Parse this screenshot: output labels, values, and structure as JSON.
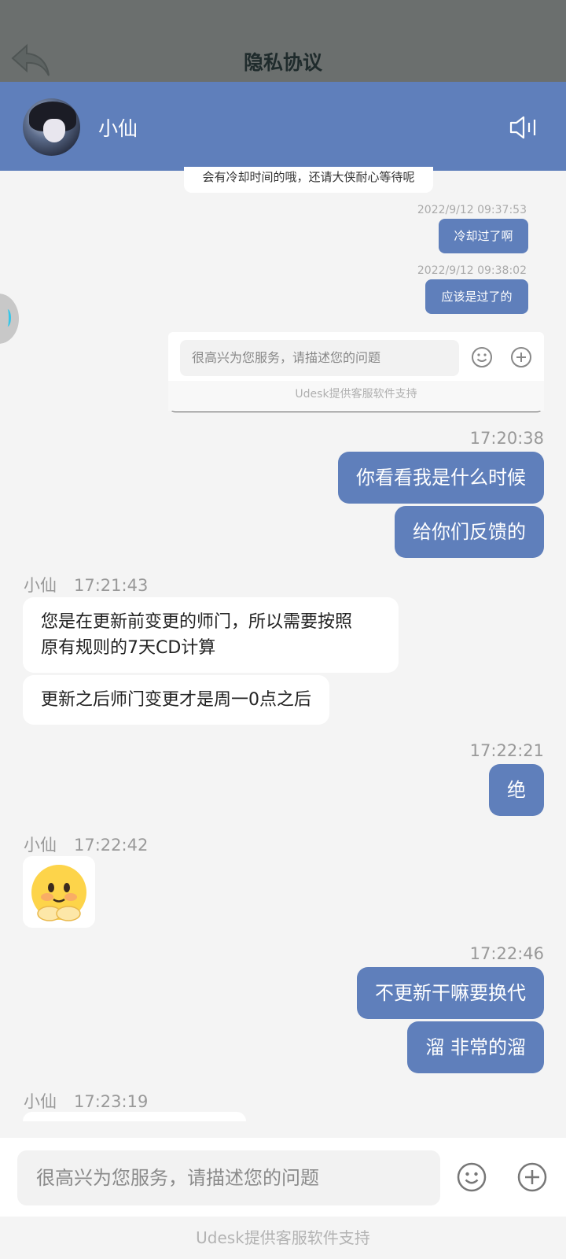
{
  "underlying_page": {
    "title": "隐私协议"
  },
  "header": {
    "agent_name": "小仙"
  },
  "nested_chat": {
    "top_bubble_text": "会有冷却时间的哦，还请大侠耐心等待呢",
    "messages": [
      {
        "time": "2022/9/12 09:37:53",
        "text": "冷却过了啊"
      },
      {
        "time": "2022/9/12 09:38:02",
        "text": "应该是过了的"
      }
    ],
    "input_placeholder": "很高兴为您服务，请描述您的问题",
    "footer": "Udesk提供客服软件支持"
  },
  "messages": {
    "g1": {
      "time": "17:20:38",
      "m1": "你看看我是什么时候",
      "m2": "给你们反馈的"
    },
    "g2": {
      "sender": "小仙",
      "time": "17:21:43",
      "m1_line1": "您是在更新前变更的师门，所以需要按照",
      "m1_line2": "原有规则的7天CD计算",
      "m2": "更新之后师门变更才是周一0点之后"
    },
    "g3": {
      "time": "17:22:21",
      "m1": "绝"
    },
    "g4": {
      "sender": "小仙",
      "time": "17:22:42"
    },
    "g5": {
      "time": "17:22:46",
      "m1": "不更新干嘛要换代",
      "m2": "溜 非常的溜"
    },
    "g6": {
      "sender": "小仙",
      "time": "17:23:19"
    }
  },
  "input": {
    "placeholder": "很高兴为您服务，请描述您的问题"
  },
  "footer": {
    "text": "Udesk提供客服软件支持"
  },
  "colors": {
    "accent": "#5f7fbb",
    "background": "#f4f4f4",
    "dim_bar": "#6b6f6e"
  }
}
